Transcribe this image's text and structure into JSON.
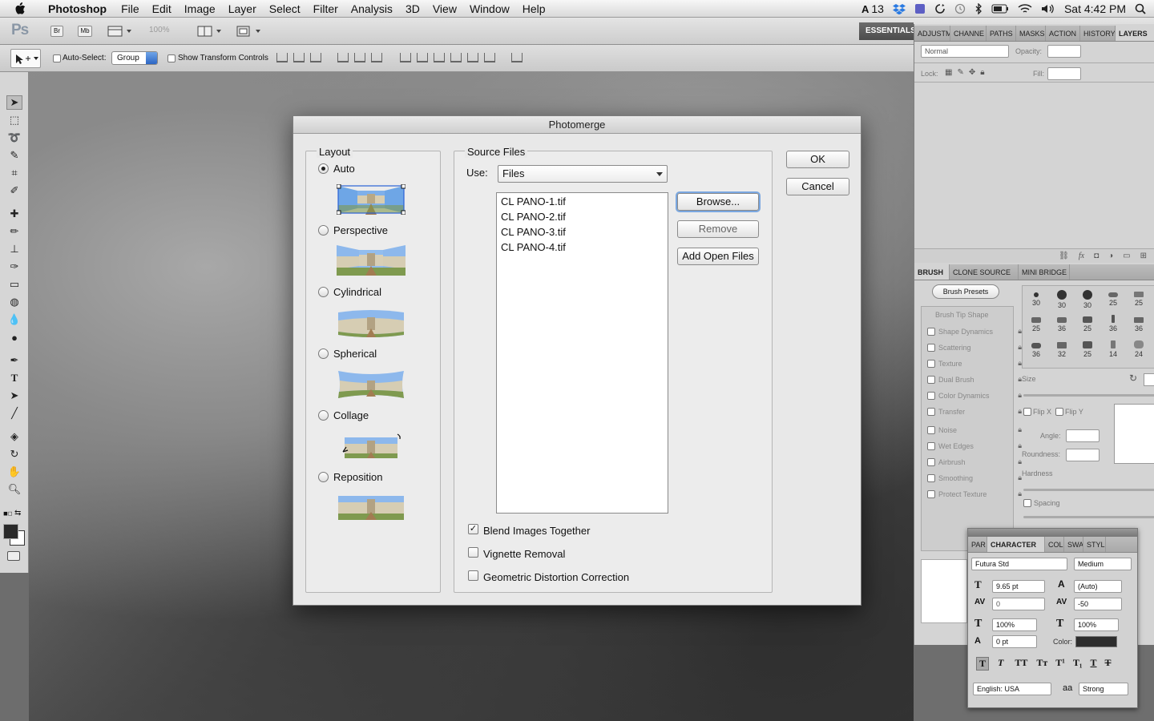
{
  "menubar": {
    "app_name": "Photoshop",
    "items": [
      "File",
      "Edit",
      "Image",
      "Layer",
      "Select",
      "Filter",
      "Analysis",
      "3D",
      "View",
      "Window",
      "Help"
    ],
    "status_number": "13",
    "clock": "Sat 4:42 PM"
  },
  "appbar": {
    "logo": "Ps",
    "bridge": "Br",
    "minibridge": "Mb",
    "zoom": "100%",
    "workspace": "ESSENTIALS"
  },
  "options": {
    "auto_select_label": "Auto-Select:",
    "auto_select_value": "Group",
    "transform_label": "Show Transform Controls"
  },
  "layers_panel": {
    "tabs": [
      "ADJUSTM",
      "CHANNE",
      "PATHS",
      "MASKS",
      "ACTION",
      "HISTORY",
      "LAYERS"
    ],
    "blend_mode": "Normal",
    "opacity_label": "Opacity:",
    "lock_label": "Lock:",
    "fill_label": "Fill:"
  },
  "brush_panel": {
    "tabs": [
      "BRUSH",
      "CLONE SOURCE",
      "MINI BRIDGE"
    ],
    "presets_button": "Brush Presets",
    "options": [
      "Brush Tip Shape",
      "Shape Dynamics",
      "Scattering",
      "Texture",
      "Dual Brush",
      "Color Dynamics",
      "Transfer",
      "Noise",
      "Wet Edges",
      "Airbrush",
      "Smoothing",
      "Protect Texture"
    ],
    "sizes": [
      "30",
      "30",
      "30",
      "25",
      "25",
      "25",
      "36",
      "25",
      "36",
      "36",
      "36",
      "32",
      "25",
      "14",
      "24"
    ],
    "size_label": "Size",
    "flip_x": "Flip X",
    "flip_y": "Flip Y",
    "angle_label": "Angle:",
    "roundness_label": "Roundness:",
    "hardness_label": "Hardness",
    "spacing_label": "Spacing"
  },
  "character_panel": {
    "tabs": [
      "PAR",
      "CHARACTER",
      "COL",
      "SWA",
      "STYL"
    ],
    "font_family": "Futura Std",
    "font_style": "Medium",
    "font_size": "9.65 pt",
    "leading": "(Auto)",
    "kerning": "0",
    "tracking": "-50",
    "vscale": "100%",
    "hscale": "100%",
    "baseline": "0 pt",
    "color_label": "Color:",
    "language": "English: USA",
    "antialias": "Strong",
    "aa_icon": "aa"
  },
  "dialog": {
    "title": "Photomerge",
    "layout_label": "Layout",
    "layouts": [
      "Auto",
      "Perspective",
      "Cylindrical",
      "Spherical",
      "Collage",
      "Reposition"
    ],
    "selected_layout": "Auto",
    "source_label": "Source Files",
    "use_label": "Use:",
    "use_value": "Files",
    "files": [
      "CL PANO-1.tif",
      "CL PANO-2.tif",
      "CL PANO-3.tif",
      "CL PANO-4.tif"
    ],
    "browse": "Browse...",
    "remove": "Remove",
    "add_open": "Add Open Files",
    "ok": "OK",
    "cancel": "Cancel",
    "blend": "Blend Images Together",
    "vignette": "Vignette Removal",
    "geometric": "Geometric Distortion Correction",
    "blend_checked": true,
    "vignette_checked": false,
    "geometric_checked": false
  }
}
